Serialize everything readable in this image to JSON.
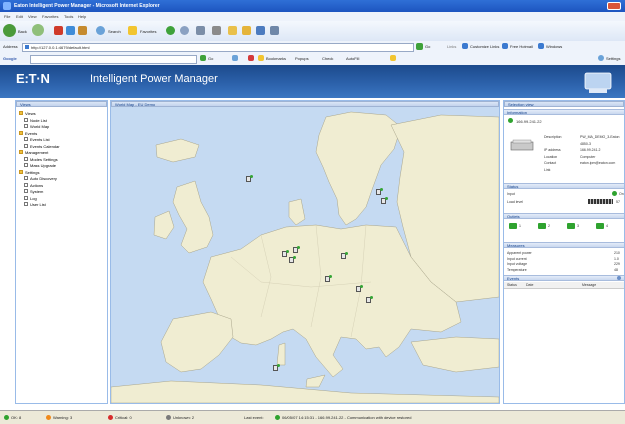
{
  "window": {
    "title": "Eaton Intelligent Power Manager - Microsoft Internet Explorer"
  },
  "menu": [
    "File",
    "Edit",
    "View",
    "Favorites",
    "Tools",
    "Help"
  ],
  "toolbar": {
    "back_label": "Back",
    "search_label": "Search",
    "favorites_label": "Favorites"
  },
  "address": {
    "label": "Address",
    "url": "http://127.0.0.1:4679/default.html",
    "go_label": "Go",
    "links_label": "Links",
    "link_items": [
      "Customize Links",
      "Free Hotmail",
      "Windows"
    ]
  },
  "google": {
    "label": "Google",
    "go_label": "Go",
    "bookmarks_label": "Bookmarks",
    "popups_label": "Popups",
    "check_label": "Check",
    "autofill_label": "AutoFill",
    "settings_label": "Settings"
  },
  "header": {
    "logo": "E:T·N",
    "app_title": "Intelligent Power Manager"
  },
  "views_panel": {
    "title": "Views",
    "tree": [
      {
        "label": "Views",
        "level": 0,
        "type": "folder"
      },
      {
        "label": "Node List",
        "level": 1,
        "type": "page"
      },
      {
        "label": "World Map",
        "level": 1,
        "type": "page"
      },
      {
        "label": "Events",
        "level": 0,
        "type": "folder"
      },
      {
        "label": "Events List",
        "level": 1,
        "type": "page"
      },
      {
        "label": "Events Calendar",
        "level": 1,
        "type": "page"
      },
      {
        "label": "Management",
        "level": 0,
        "type": "folder"
      },
      {
        "label": "Modes Settings",
        "level": 1,
        "type": "page"
      },
      {
        "label": "Mass Upgrade",
        "level": 1,
        "type": "page"
      },
      {
        "label": "Settings",
        "level": 0,
        "type": "folder"
      },
      {
        "label": "Auto Discovery",
        "level": 1,
        "type": "page"
      },
      {
        "label": "Actions",
        "level": 1,
        "type": "page"
      },
      {
        "label": "System",
        "level": 1,
        "type": "page"
      },
      {
        "label": "Log",
        "level": 1,
        "type": "page"
      },
      {
        "label": "User List",
        "level": 1,
        "type": "page"
      }
    ]
  },
  "map_panel": {
    "title": "World Map - EU Demo"
  },
  "selection_panel": {
    "title": "Selection view",
    "information": {
      "title": "Information",
      "ip": "166.99.241.22",
      "fields": [
        {
          "label": "Description",
          "value": "PW_MA_DEMO_3-Eaton"
        },
        {
          "label": "",
          "value": "4850-3"
        },
        {
          "label": "IP address",
          "value": "166.99.241.2"
        },
        {
          "label": "Location",
          "value": "Computer"
        },
        {
          "label": "Contact",
          "value": "eaton.ipm@eaton.com"
        },
        {
          "label": "Link",
          "value": ""
        }
      ]
    },
    "status": {
      "title": "Status",
      "input_label": "Input",
      "input_value": "On",
      "load_label": "Load level",
      "load_value": "57"
    },
    "outlets": {
      "title": "Outlets",
      "items": [
        "1",
        "2",
        "3",
        "4"
      ]
    },
    "measures": {
      "title": "Measures",
      "fields": [
        {
          "label": "Apparent power",
          "value": "210"
        },
        {
          "label": "Input current",
          "value": "1.0"
        },
        {
          "label": "Input voltage",
          "value": "229"
        },
        {
          "label": "Temperature",
          "value": "48"
        }
      ]
    },
    "events": {
      "title": "Events",
      "columns": [
        "Status",
        "Date",
        "Message"
      ]
    }
  },
  "statusbar": {
    "items": [
      {
        "label": "OK: 8",
        "color": "#2fa32f"
      },
      {
        "label": "Warning: 3",
        "color": "#f08a1b"
      },
      {
        "label": "Critical: 0",
        "color": "#d62c2c"
      },
      {
        "label": "Unknown: 2",
        "color": "#7a7a7a"
      }
    ],
    "last_event_label": "Last event:",
    "last_event": "06/05/07 14:15:31 - 166.99.241.22 - Communication with device restored"
  }
}
